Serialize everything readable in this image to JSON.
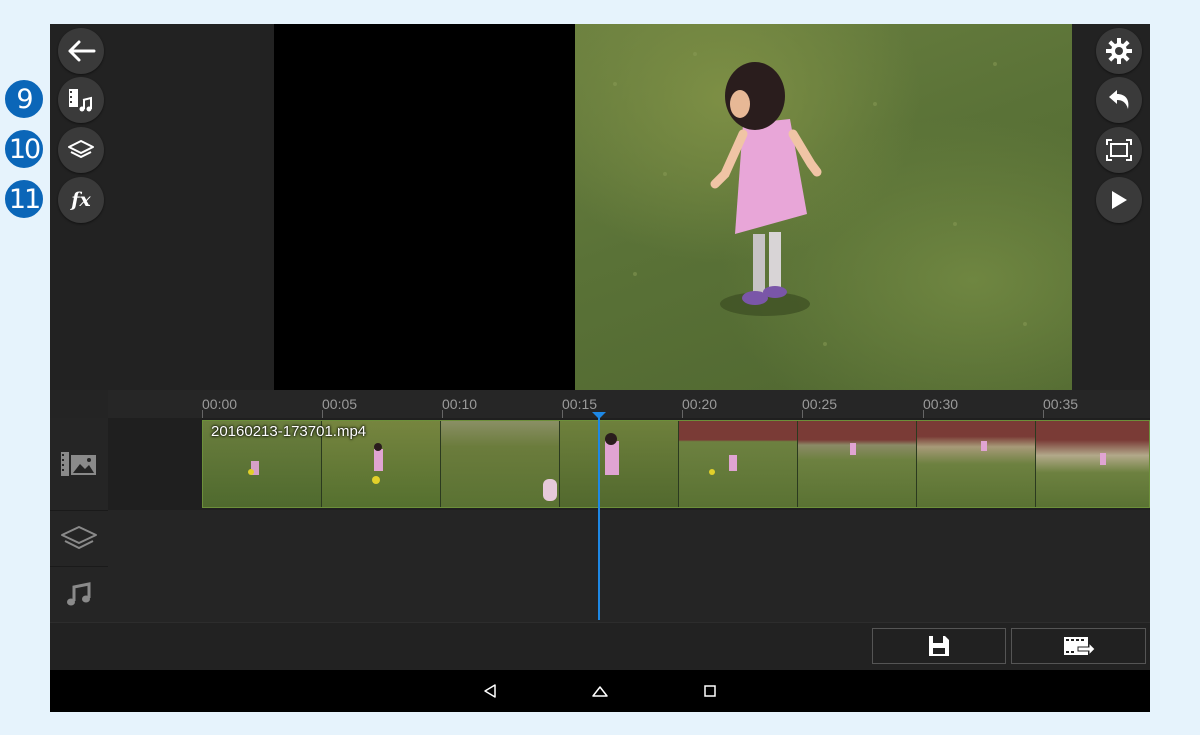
{
  "left_toolbar": {
    "back_icon": "arrow-left-icon",
    "media_icon": "film-music-icon",
    "layer_icon": "layers-icon",
    "fx_label": "fx"
  },
  "callouts": [
    "9",
    "10",
    "11"
  ],
  "right_toolbar": {
    "settings_icon": "gear-icon",
    "undo_icon": "undo-icon",
    "fullscreen_icon": "fullscreen-icon",
    "play_icon": "play-icon"
  },
  "timeline": {
    "ruler_labels": [
      "00:00",
      "00:05",
      "00:10",
      "00:15",
      "00:20",
      "00:25",
      "00:30",
      "00:35"
    ],
    "clip_name": "20160213-173701.mp4",
    "tracks": [
      "video-track",
      "layer-track",
      "audio-track"
    ]
  },
  "bottom_toolbar": {
    "save_icon": "save-icon",
    "export_icon": "export-video-icon"
  },
  "nav_bar": {
    "back_icon": "nav-back-icon",
    "home_icon": "nav-home-icon",
    "recents_icon": "nav-recents-icon"
  },
  "colors": {
    "accent": "#1e88e5",
    "callout": "#0b66b8",
    "background": "#222222"
  }
}
